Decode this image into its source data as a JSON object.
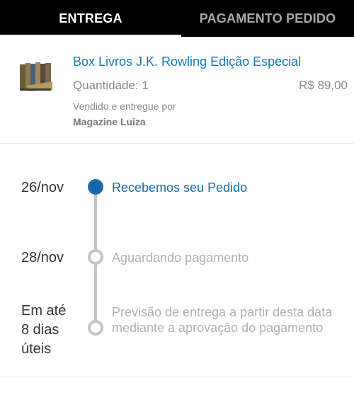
{
  "tabs": {
    "entrega": "ENTREGA",
    "pagamento": "PAGAMENTO PEDIDO"
  },
  "product": {
    "title": "Box Livros J.K. Rowling Edição Especial",
    "quantity": "Quantidade: 1",
    "price": "R$ 89,00",
    "seller_label": "Vendido e entregue por",
    "seller_name": "Magazine Luiza"
  },
  "timeline": {
    "steps": [
      {
        "date": "26/nov",
        "label": "Recebemos seu Pedido",
        "status": "done"
      },
      {
        "date": "28/nov",
        "label": "Aguardando pagamento",
        "status": "pending"
      },
      {
        "date": "Em até 8 dias úteis",
        "label": "Previsão de entrega a partir desta data mediante a aprovação do pagamento",
        "status": "pending"
      }
    ]
  },
  "colors": {
    "tab_bar": "#000000",
    "link_blue": "#1a78b4",
    "active_dot": "#1566a8",
    "inactive_gray": "#c4c4c4"
  }
}
